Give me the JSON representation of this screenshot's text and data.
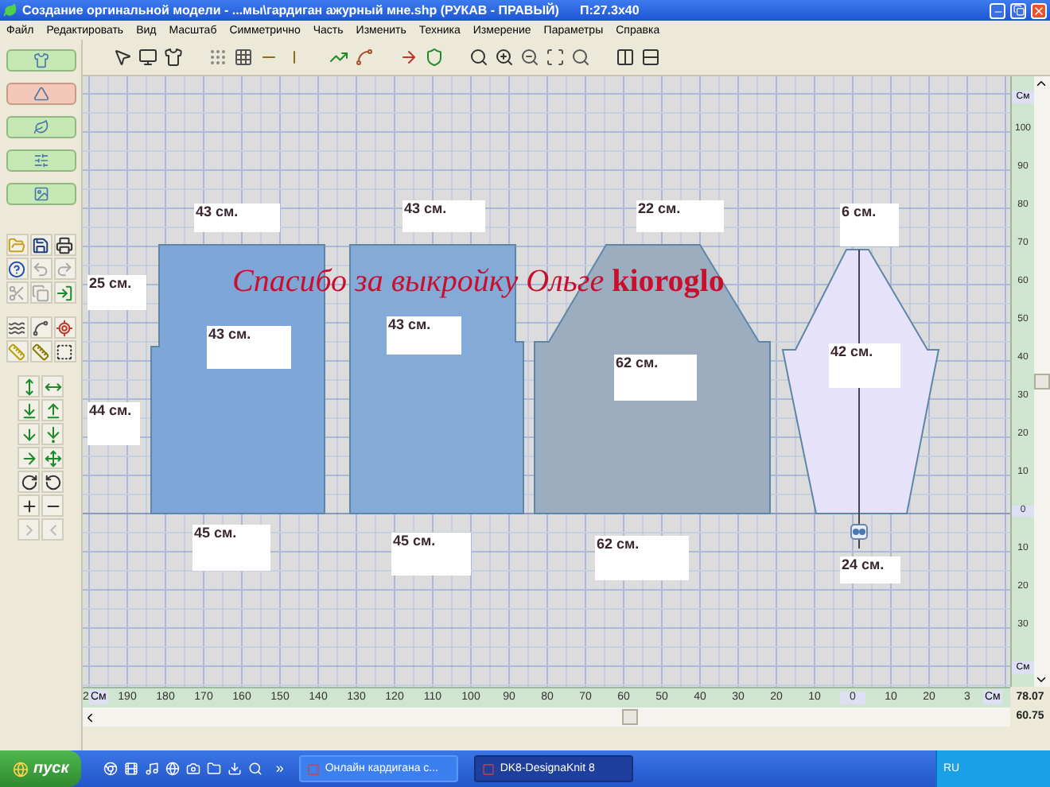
{
  "window": {
    "title": "Создание оргинальной модели - ...мы\\гардиган ажурный мне.shp (РУКАВ - ПРАВЫЙ)",
    "size": "П:27.3x40"
  },
  "menu": [
    "Файл",
    "Редактировать",
    "Вид",
    "Масштаб",
    "Симметрично",
    "Часть",
    "Изменить",
    "Техника",
    "Измерение",
    "Параметры",
    "Справка"
  ],
  "mode_buttons": [
    {
      "selected": false
    },
    {
      "selected": true
    },
    {
      "selected": false
    },
    {
      "selected": false
    },
    {
      "selected": false
    }
  ],
  "canvas": {
    "caption": "Спасибо за выкройку Ольге **kioroglo**",
    "pieces": [
      {
        "color": "#7ea6d6"
      },
      {
        "color": "#84aad8"
      },
      {
        "color": "#9cadc0"
      },
      {
        "color": "#e6e2fa"
      }
    ],
    "labels": [
      "43 см.",
      "43 см.",
      "22 см.",
      "6 см.",
      "25 см.",
      "43 см.",
      "43 см.",
      "62 см.",
      "42 см.",
      "44 см.",
      "45 см.",
      "45 см.",
      "62 см.",
      "24 см."
    ]
  },
  "vertical_ruler": {
    "unit_top": "См",
    "ticks": [
      "100",
      "90",
      "80",
      "70",
      "60",
      "50",
      "40",
      "30",
      "20",
      "10",
      "0",
      "10",
      "20",
      "30"
    ],
    "unit_bottom": "См"
  },
  "horizontal_ruler": {
    "unit_left": "См",
    "ticks": [
      "2",
      "190",
      "180",
      "170",
      "160",
      "150",
      "140",
      "130",
      "120",
      "110",
      "100",
      "90",
      "80",
      "70",
      "60",
      "50",
      "40",
      "30",
      "20",
      "10",
      "0",
      "10",
      "20",
      "3"
    ],
    "unit_right": "См"
  },
  "readouts": [
    "78.07",
    "60.75"
  ],
  "taskbar": {
    "start": "пуск",
    "overflow": "»",
    "tasks": [
      {
        "label": "Онлайн кардигана с...",
        "selected": false
      },
      {
        "label": "DK8-DesignaKnit 8",
        "selected": true
      }
    ],
    "language": "RU"
  }
}
